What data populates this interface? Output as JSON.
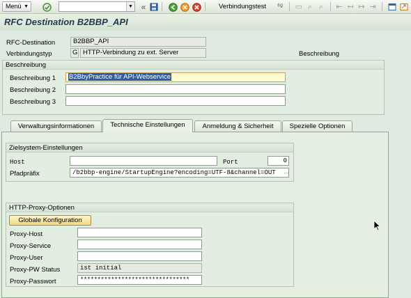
{
  "toolbar": {
    "menu_label": "Menü",
    "command_field_value": "",
    "connection_test_label": "Verbindungstest",
    "icons": [
      "save-icon",
      "back-icon",
      "exit-icon",
      "cancel-icon",
      "print-icon",
      "find-icon",
      "find-next-icon",
      "first-page-icon",
      "prev-page-icon",
      "next-page-icon",
      "last-page-icon",
      "new-session-icon",
      "shortcut-icon"
    ]
  },
  "title": "RFC Destination B2BBP_API",
  "header": {
    "rfc_destination_label": "RFC-Destination",
    "rfc_destination_value": "B2BBP_API",
    "connection_type_label": "Verbindungstyp",
    "connection_type_code": "G",
    "connection_type_text": "HTTP-Verbindung zu ext. Server",
    "description_side_label": "Beschreibung"
  },
  "description_group": {
    "title": "Beschreibung",
    "desc1_label": "Beschreibung 1",
    "desc1_value": "B2BbyPractice für API-Webservice",
    "desc2_label": "Beschreibung 2",
    "desc2_value": "",
    "desc3_label": "Beschreibung 3",
    "desc3_value": ""
  },
  "tabs": [
    {
      "label": "Verwaltungsinformationen",
      "active": false
    },
    {
      "label": "Technische Einstellungen",
      "active": true
    },
    {
      "label": "Anmeldung & Sicherheit",
      "active": false
    },
    {
      "label": "Spezielle Optionen",
      "active": false
    }
  ],
  "target_system": {
    "title": "Zielsystem-Einstellungen",
    "host_label": "Host",
    "host_value": "",
    "port_label": "Port",
    "port_value": "0",
    "path_label": "Pfadpräfix",
    "path_value": "/b2bbp-engine/StartupEngine?encoding=UTF-8&channel=OUT"
  },
  "proxy": {
    "title": "HTTP-Proxy-Optionen",
    "global_config_button": "Globale Konfiguration",
    "host_label": "Proxy-Host",
    "host_value": "",
    "service_label": "Proxy-Service",
    "service_value": "",
    "user_label": "Proxy-User",
    "user_value": "",
    "pw_status_label": "Proxy-PW Status",
    "pw_status_value": "ist initial",
    "password_label": "Proxy-Passwort",
    "password_value": "********************************"
  },
  "colors": {
    "background": "#dfebe0",
    "title_text": "#1f3a4d",
    "selection": "#2d5ea3",
    "button_gold": "#f2d98c"
  }
}
